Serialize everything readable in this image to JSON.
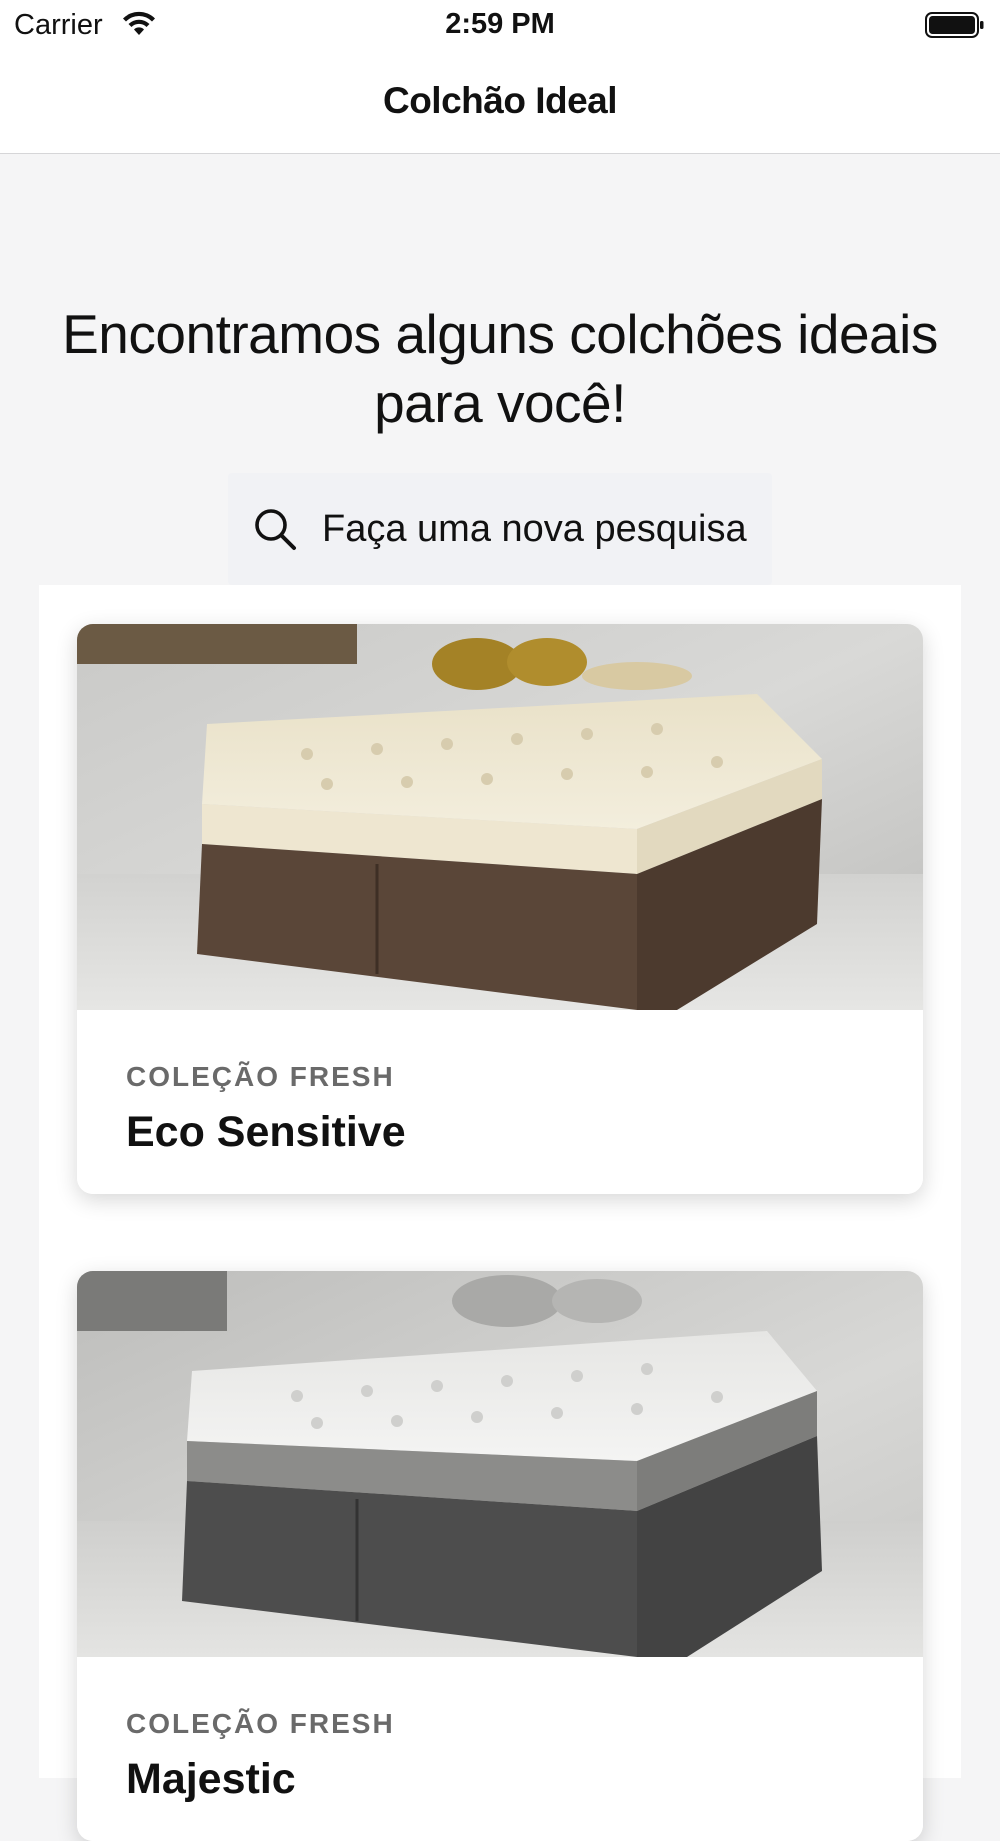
{
  "status_bar": {
    "carrier": "Carrier",
    "time": "2:59 PM"
  },
  "nav": {
    "title": "Colchão Ideal"
  },
  "main": {
    "headline": "Encontramos alguns colchões ideais para você!",
    "search_label": "Faça uma nova pesquisa"
  },
  "products": [
    {
      "collection": "COLEÇÃO FRESH",
      "name": "Eco Sensitive",
      "image": "brown mattress on box base in a bedroom"
    },
    {
      "collection": "COLEÇÃO FRESH",
      "name": "Majestic",
      "image": "grey mattress on box base in a bedroom"
    }
  ],
  "colors": {
    "background": "#f5f5f6",
    "search_bg": "#f1f2f5",
    "collection_text": "#6a6a6a"
  }
}
